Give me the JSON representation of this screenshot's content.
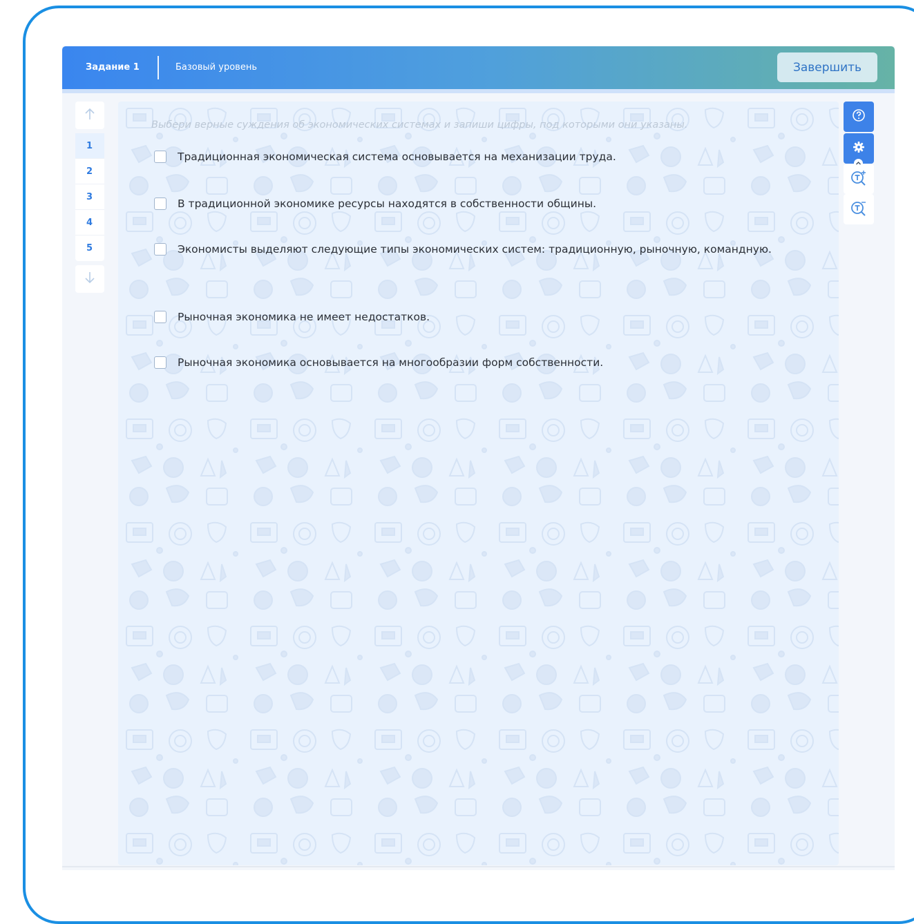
{
  "header": {
    "task_label": "Задание 1",
    "level_label": "Базовый уровень",
    "finish_label": "Завершить"
  },
  "nav": {
    "up_icon": "arrow-up-icon",
    "down_icon": "arrow-down-icon",
    "items": [
      {
        "label": "1",
        "active": true
      },
      {
        "label": "2",
        "active": false
      },
      {
        "label": "3",
        "active": false
      },
      {
        "label": "4",
        "active": false
      },
      {
        "label": "5",
        "active": false
      }
    ]
  },
  "task": {
    "instruction": "Выбери верные суждения об экономических системах и запиши цифры, под которыми они указаны.",
    "options": [
      {
        "text": "Традиционная экономическая система основывается на механизации труда.",
        "checked": false
      },
      {
        "text": "В традиционной экономике ресурсы находятся в собственности общины.",
        "checked": false
      },
      {
        "text": "Экономисты выделяют следующие типы экономических систем: традиционную, рыночную, командную.",
        "checked": false
      },
      {
        "text": "Рыночная экономика не имеет недостатков.",
        "checked": false
      },
      {
        "text": "Рыночная экономика основывается на многообразии форм собственности.",
        "checked": false
      }
    ]
  },
  "tools": {
    "help_icon": "help-icon",
    "settings_icon": "gear-icon",
    "zoom_in_icon": "text-zoom-in-icon",
    "zoom_out_icon": "text-zoom-out-icon"
  },
  "colors": {
    "frame": "#1a8fe3",
    "header_start": "#3a86ef",
    "header_end": "#66b3a6",
    "accent": "#3d82e8",
    "nav_text": "#2f7be0",
    "content_bg": "#e9f2fd"
  }
}
